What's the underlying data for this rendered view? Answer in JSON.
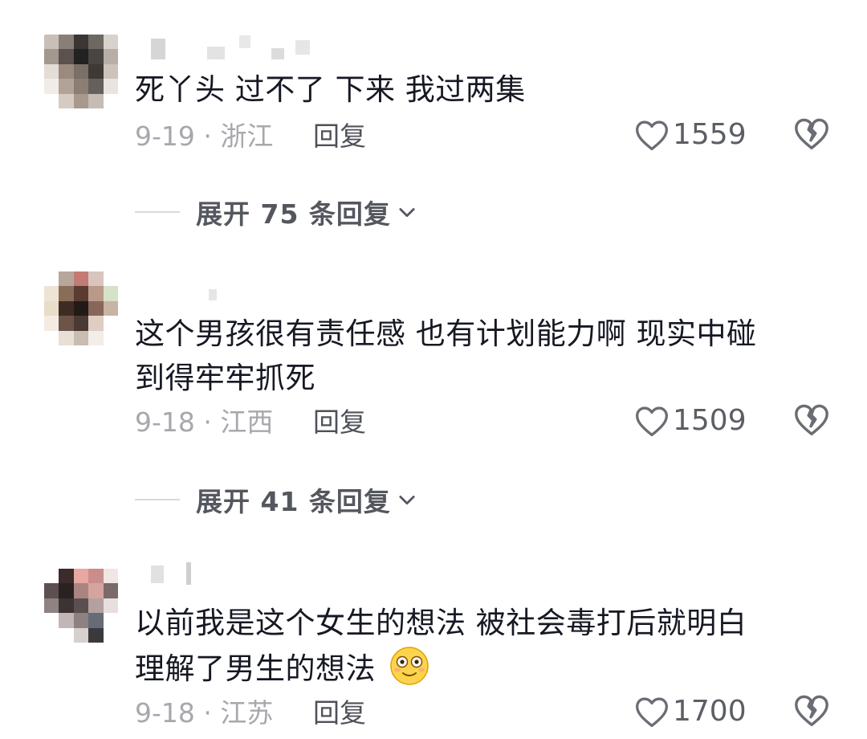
{
  "comments": [
    {
      "text_lines": [
        "死丫头 过不了 下来 我过两集"
      ],
      "date_location": "9-19 · 浙江",
      "reply_label": "回复",
      "likes": "1559",
      "expand_label": "展开 75 条回复"
    },
    {
      "text_lines": [
        "这个男孩很有责任感 也有计划能力啊 现实中碰",
        "到得牢牢抓死"
      ],
      "date_location": "9-18 · 江西",
      "reply_label": "回复",
      "likes": "1509",
      "expand_label": "展开 41 条回复"
    },
    {
      "text_lines": [
        "以前我是这个女生的想法 被社会毒打后就明白",
        "理解了男生的想法"
      ],
      "date_location": "9-18 · 江苏",
      "reply_label": "回复",
      "likes": "1700"
    }
  ],
  "icons": {
    "like": "heart-outline-icon",
    "dislike": "broken-heart-icon",
    "expand": "chevron-down-icon",
    "emoji": "flushed-smile-emoji"
  },
  "colors": {
    "text": "#161823",
    "meta": "#a7a8ad",
    "reply": "#4f5159",
    "expand": "#55575f"
  }
}
